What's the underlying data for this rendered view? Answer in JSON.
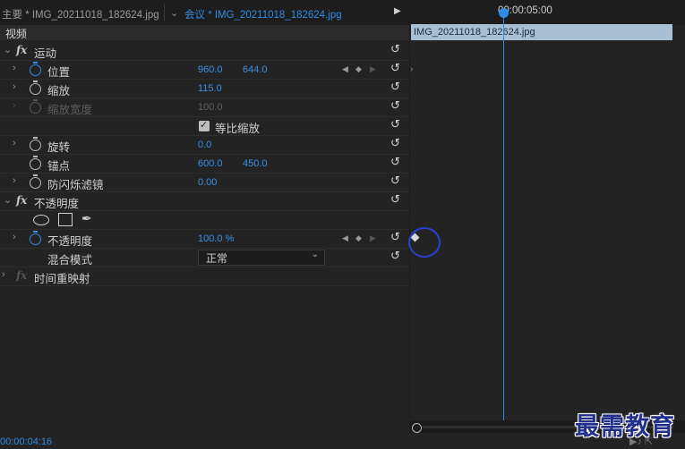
{
  "tabs": {
    "main": "主要 * IMG_20211018_182624.jpg",
    "active": "会议 * IMG_20211018_182624.jpg"
  },
  "section": "视频",
  "effects": {
    "motion": {
      "title": "运动",
      "position": {
        "label": "位置",
        "x": "960.0",
        "y": "644.0"
      },
      "scale": {
        "label": "缩放",
        "value": "115.0"
      },
      "scale_width": {
        "label": "缩放宽度",
        "value": "100.0"
      },
      "uniform_scale": {
        "label": "等比缩放",
        "checked": true
      },
      "rotation": {
        "label": "旋转",
        "value": "0.0"
      },
      "anchor": {
        "label": "锚点",
        "x": "600.0",
        "y": "450.0"
      },
      "anti_flicker": {
        "label": "防闪烁滤镜",
        "value": "0.00"
      }
    },
    "opacity": {
      "title": "不透明度",
      "opacity": {
        "label": "不透明度",
        "value": "100.0 %"
      },
      "blend": {
        "label": "混合模式",
        "value": "正常"
      }
    },
    "time_remap": {
      "title": "时间重映射"
    }
  },
  "timeline": {
    "ruler_time": "00:00:05:00",
    "clip_name": "IMG_20211018_182624.jpg"
  },
  "timecode": "00:00:04:16",
  "watermark": "最需教育",
  "icons": {
    "reset": "reset-arrow-icon",
    "stopwatch": "stopwatch-icon",
    "ellipse": "ellipse-mask-icon",
    "rect": "rectangle-mask-icon",
    "pen": "pen-mask-icon"
  },
  "colors": {
    "accent": "#2e8be6",
    "clip": "#a9bfd4"
  }
}
